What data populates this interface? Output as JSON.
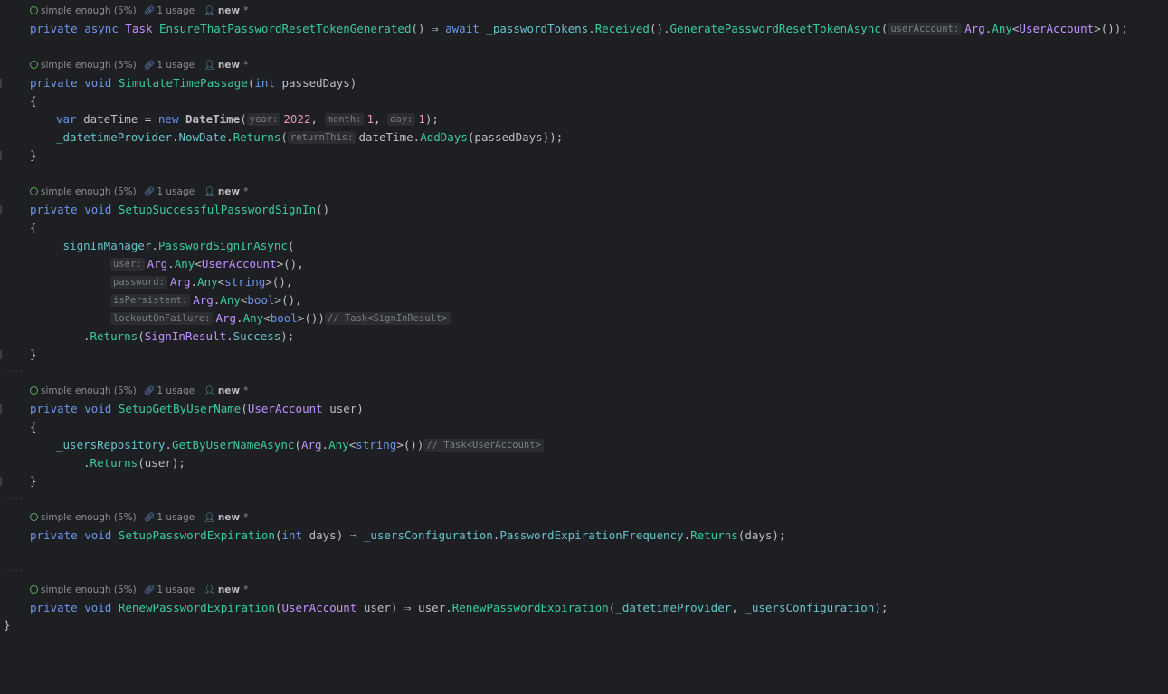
{
  "lens": {
    "complexity": "simple enough (5%)",
    "usages": "1 usage",
    "author": "new",
    "modified": "*"
  },
  "code": {
    "private": "private",
    "async": "async",
    "void": "void",
    "int": "int",
    "var": "var",
    "new": "new",
    "await": "await",
    "arrow": "⇒",
    "task": "Task",
    "m1_name": "EnsureThatPasswordResetTokenGenerated",
    "m1_tokens": "_passwordTokens",
    "m1_received": "Received",
    "m1_generate": "GeneratePasswordResetTokenAsync",
    "hint_useraccount": "userAccount:",
    "arg": "Arg",
    "any": "Any",
    "useraccount_type": "UserAccount",
    "m2_name": "SimulateTimePassage",
    "m2_param": "passedDays",
    "m2_local": "dateTime",
    "datetime_type": "DateTime",
    "hint_year": "year:",
    "hint_month": "month:",
    "hint_day": "day:",
    "year_val": "2022",
    "month_val": "1",
    "day_val": "1",
    "m2_provider": "_datetimeProvider",
    "nowdate": "NowDate",
    "returns": "Returns",
    "hint_returnthis": "returnThis:",
    "adddays": "AddDays",
    "m3_name": "SetupSuccessfulPasswordSignIn",
    "m3_signin": "_signInManager",
    "m3_pwdsignin": "PasswordSignInAsync",
    "hint_user": "user:",
    "hint_password": "password:",
    "hint_ispersistent": "isPersistent:",
    "hint_lockout": "lockoutOnFailure:",
    "string_type": "string",
    "bool_type": "bool",
    "comment_signin": "// Task<SignInResult>",
    "signinresult": "SignInResult",
    "success": "Success",
    "m4_name": "SetupGetByUserName",
    "m4_param": "user",
    "m4_repo": "_usersRepository",
    "m4_getby": "GetByUserNameAsync",
    "comment_useraccount": "// Task<UserAccount>",
    "m5_name": "SetupPasswordExpiration",
    "m5_param": "days",
    "m5_config": "_usersConfiguration",
    "m5_freq": "PasswordExpirationFrequency",
    "m6_name": "RenewPasswordExpiration",
    "m6_renew": "RenewPasswordExpiration"
  }
}
